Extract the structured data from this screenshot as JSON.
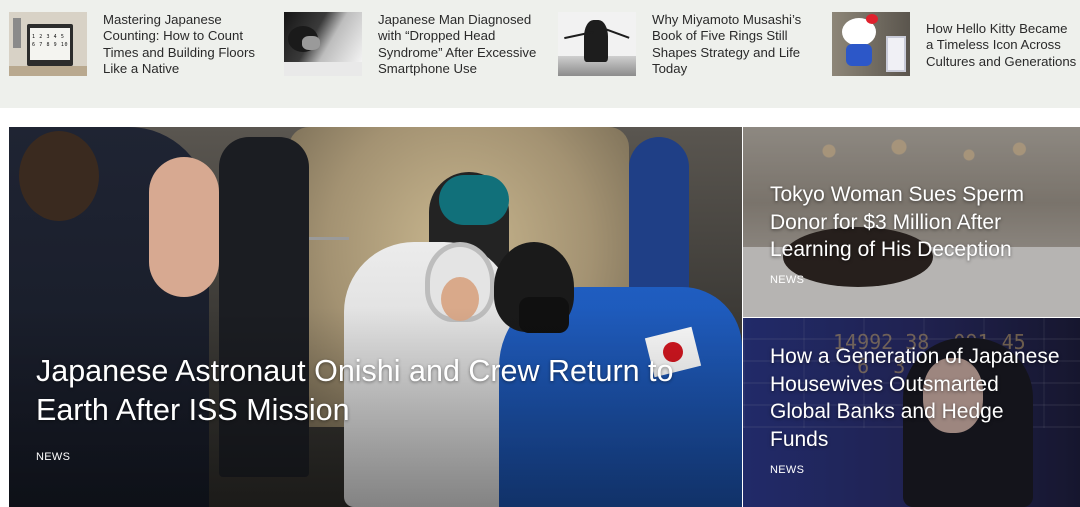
{
  "top_strip": {
    "items": [
      {
        "title": "Mastering Japanese Counting: How to Count Times and Building Floors Like a Native",
        "thumb_icon": "keypad-monitor-image",
        "keypad_text": "1 2 3 4 5\n6 7 8 9 10"
      },
      {
        "title": "Japanese Man Diagnosed with “Dropped Head Syndrome” After Excessive Smartphone Use",
        "thumb_icon": "man-with-phone-image"
      },
      {
        "title": "Why Miyamoto Musashi’s Book of Five Rings Still Shapes Strategy and Life Today",
        "thumb_icon": "samurai-silhouette-image"
      },
      {
        "title": "How Hello Kitty Became a Timeless Icon Across Cultures and Generations",
        "thumb_icon": "hello-kitty-image"
      }
    ]
  },
  "hero": {
    "title": "Japanese Astronaut Onishi and Crew Return to Earth After ISS Mission",
    "category": "NEWS"
  },
  "side_cards": [
    {
      "title": "Tokyo Woman Sues Sperm Donor for $3 Million After Learning of His Deception",
      "category": "NEWS"
    },
    {
      "title": "How a Generation of Japanese Housewives Outsmarted Global Banks and Hedge Funds",
      "category": "NEWS",
      "board_text": "14992 38  091.45\n  6  3   69.99\n         3.55"
    }
  ],
  "colors": {
    "strip_bg": "#eef0ec",
    "flag_red": "#d1161f",
    "suit_blue": "#1f5dc0"
  }
}
